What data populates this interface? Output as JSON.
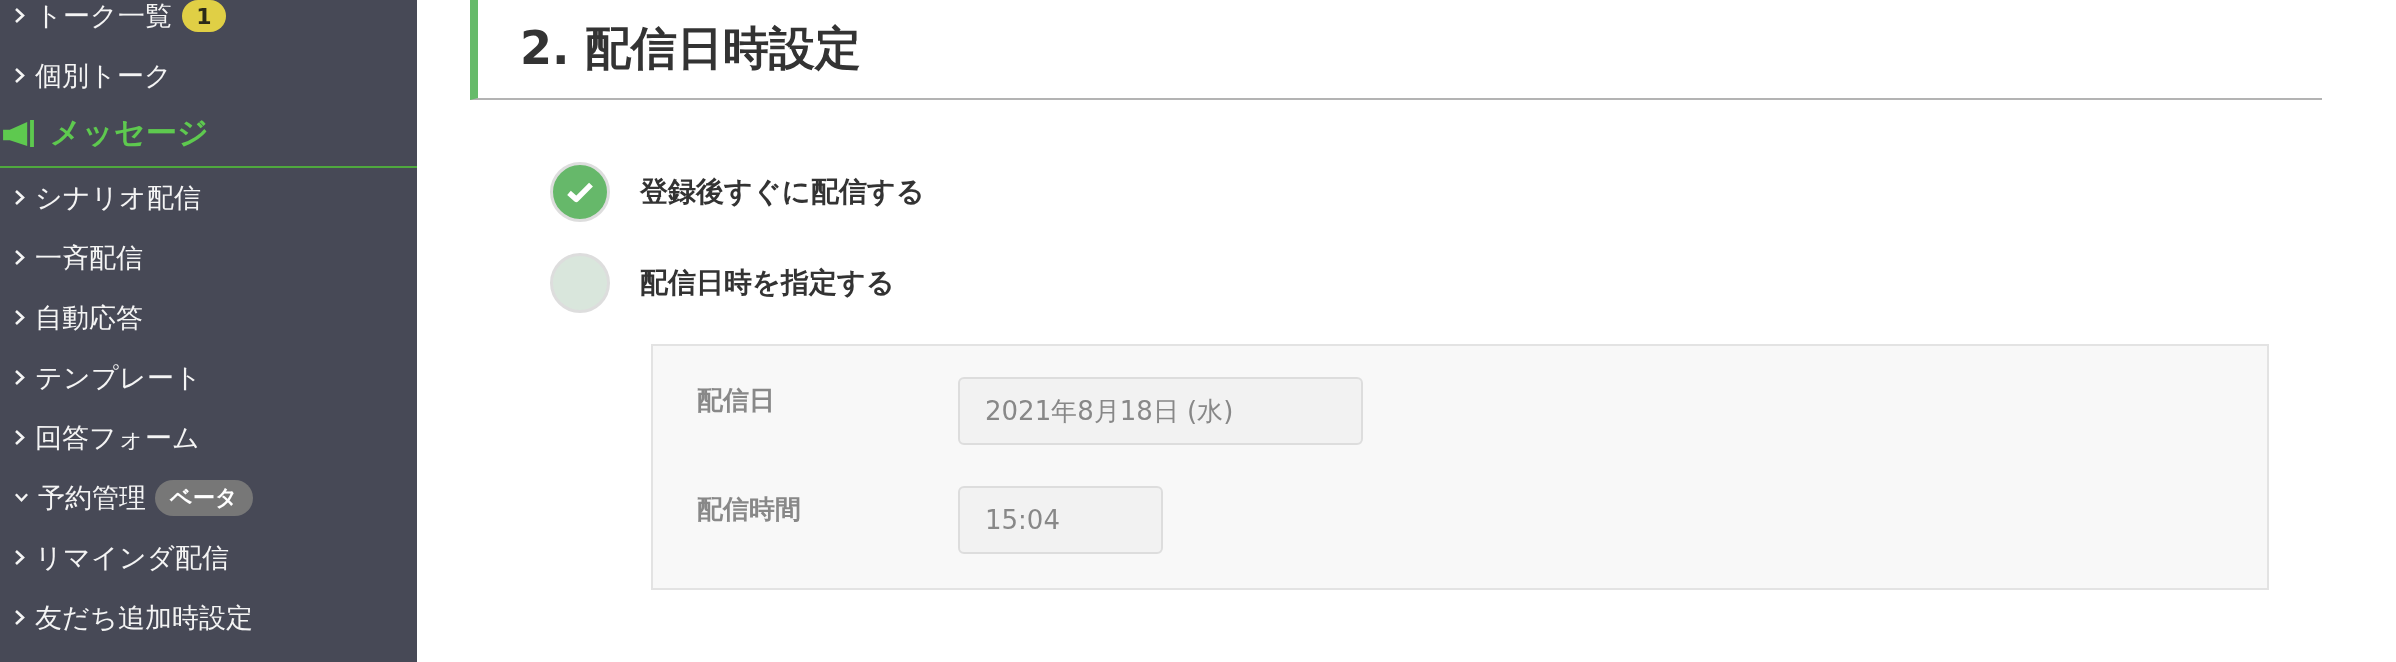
{
  "sidebar": {
    "items": [
      {
        "kind": "link",
        "label": "トーク一覧",
        "expanded": false,
        "badge": {
          "kind": "count",
          "text": "1"
        }
      },
      {
        "kind": "link",
        "label": "個別トーク",
        "expanded": false
      },
      {
        "kind": "section",
        "label": "メッセージ"
      },
      {
        "kind": "link",
        "label": "シナリオ配信",
        "expanded": false
      },
      {
        "kind": "link",
        "label": "一斉配信",
        "expanded": false
      },
      {
        "kind": "link",
        "label": "自動応答",
        "expanded": false
      },
      {
        "kind": "link",
        "label": "テンプレート",
        "expanded": false
      },
      {
        "kind": "link",
        "label": "回答フォーム",
        "expanded": false
      },
      {
        "kind": "link",
        "label": "予約管理",
        "expanded": true,
        "badge": {
          "kind": "tag",
          "text": "ベータ"
        }
      },
      {
        "kind": "link",
        "label": "リマインダ配信",
        "expanded": false
      },
      {
        "kind": "link",
        "label": "友だち追加時設定",
        "expanded": false
      }
    ]
  },
  "section": {
    "title": "2. 配信日時設定"
  },
  "delivery_options": [
    {
      "label": "登録後すぐに配信する",
      "selected": true
    },
    {
      "label": "配信日時を指定する",
      "selected": false
    }
  ],
  "schedule": {
    "disabled": true,
    "fields": [
      {
        "kind": "date",
        "label": "配信日",
        "value": "2021年8月18日 (水)"
      },
      {
        "kind": "time",
        "label": "配信時間",
        "value": "15:04"
      }
    ]
  }
}
